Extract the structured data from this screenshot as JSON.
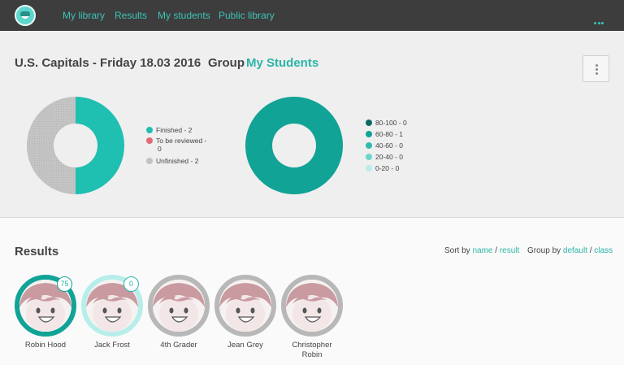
{
  "nav": {
    "items": [
      "My library",
      "Results",
      "My students",
      "Public library"
    ]
  },
  "header": {
    "title": "U.S. Capitals - Friday 18.03 2016",
    "group_label": "Group",
    "group_name": "My Students"
  },
  "colors": {
    "accent": "#2ab5a8",
    "finished": "#1fbfb2",
    "to_review": "#e06b78",
    "unfinished": "#c2c2c2",
    "range_80_100": "#0c6b62",
    "range_60_80": "#11a396",
    "range_40_60": "#2fbcb0",
    "range_20_40": "#6ad6cd",
    "range_0_20": "#b6eeea"
  },
  "status_chart": {
    "legend": [
      {
        "label": "Finished - 2",
        "color": "#1fbfb2"
      },
      {
        "label": "To be reviewed -",
        "label_cont": "0",
        "color": "#e06b78"
      },
      {
        "label": "Unfinished - 2",
        "color": "#c2c2c2"
      }
    ],
    "values": {
      "finished": 2,
      "to_review": 0,
      "unfinished": 2
    }
  },
  "score_chart": {
    "legend": [
      {
        "label": "80-100 - 0",
        "color": "#0c6b62"
      },
      {
        "label": "60-80 - 1",
        "color": "#11a396"
      },
      {
        "label": "40-60 - 0",
        "color": "#2fbcb0"
      },
      {
        "label": "20-40 - 0",
        "color": "#6ad6cd"
      },
      {
        "label": "0-20 - 0",
        "color": "#b6eeea"
      }
    ],
    "values": {
      "80-100": 0,
      "60-80": 1,
      "40-60": 0,
      "20-40": 0,
      "0-20": 0
    }
  },
  "results": {
    "title": "Results",
    "sort_by": "Sort by",
    "sort_name": "name",
    "sort_result": "result",
    "group_by": "Group by",
    "group_default": "default",
    "group_class": "class",
    "separator": "/",
    "students": [
      {
        "name": "Robin Hood",
        "score": "75",
        "ring": "#11a396"
      },
      {
        "name": "Jack Frost",
        "score": "0",
        "ring": "#b6eeea"
      },
      {
        "name": "4th Grader",
        "score": null,
        "ring": "#b8b8b8"
      },
      {
        "name": "Jean Grey",
        "score": null,
        "ring": "#b8b8b8"
      },
      {
        "name": "Christopher Robin",
        "score": null,
        "ring": "#b8b8b8"
      }
    ]
  }
}
